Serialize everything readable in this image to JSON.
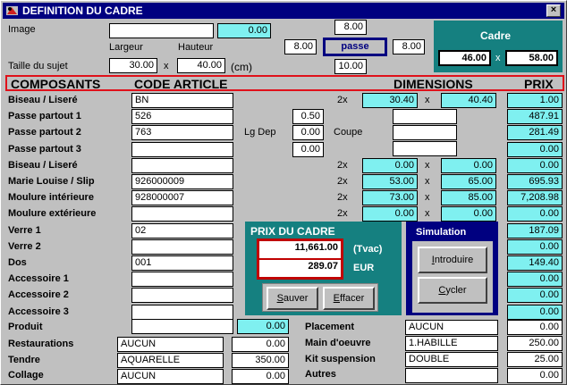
{
  "window": {
    "title": "DEFINITION DU CADRE",
    "close_label": "×"
  },
  "top": {
    "image_label": "Image",
    "image_value": "",
    "image_price": "0.00",
    "largeur_label": "Largeur",
    "hauteur_label": "Hauteur",
    "taille_label": "Taille du sujet",
    "largeur_value": "30.00",
    "x_sign": "x",
    "hauteur_value": "40.00",
    "unit": "(cm)",
    "passe_top": "8.00",
    "passe_left": "8.00",
    "passe_label": "passe",
    "passe_right": "8.00",
    "passe_bottom": "10.00",
    "cadre_title": "Cadre",
    "cadre_w": "46.00",
    "cadre_h": "58.00"
  },
  "header": {
    "composants": "COMPOSANTS",
    "code_article": "CODE ARTICLE",
    "dimensions": "DIMENSIONS",
    "prix": "PRIX"
  },
  "rows": [
    {
      "label": "Biseau / Liseré",
      "code": "BN",
      "mult": "2x",
      "dim1": "30.40",
      "x": "x",
      "dim2": "40.40",
      "prix": "1.00"
    },
    {
      "label": "Passe partout 1",
      "code": "526",
      "lg": "0.50",
      "prix": "487.91"
    },
    {
      "label": "Passe partout 2",
      "code": "763",
      "lg": "0.00",
      "prix": "281.49"
    },
    {
      "label": "Passe partout 3",
      "code": "",
      "lg": "0.00",
      "prix": "0.00"
    },
    {
      "label": "Biseau / Liseré",
      "code": "",
      "mult": "2x",
      "dim1": "0.00",
      "x": "x",
      "dim2": "0.00",
      "prix": "0.00"
    },
    {
      "label": "Marie Louise / Slip",
      "code": "926000009",
      "mult": "2x",
      "dim1": "53.00",
      "x": "x",
      "dim2": "65.00",
      "prix": "695.93"
    },
    {
      "label": "Moulure intérieure",
      "code": "928000007",
      "mult": "2x",
      "dim1": "73.00",
      "x": "x",
      "dim2": "85.00",
      "prix": "7,208.98"
    },
    {
      "label": "Moulure extérieure",
      "code": "",
      "mult": "2x",
      "dim1": "0.00",
      "x": "x",
      "dim2": "0.00",
      "prix": "0.00"
    },
    {
      "label": "Verre 1",
      "code": "02",
      "prix": "187.09"
    },
    {
      "label": "Verre 2",
      "code": "",
      "prix": "0.00"
    },
    {
      "label": "Dos",
      "code": "001",
      "prix": "149.40"
    },
    {
      "label": "Accessoire 1",
      "code": "",
      "prix": "0.00"
    },
    {
      "label": "Accessoire 2",
      "code": "",
      "prix": "0.00"
    },
    {
      "label": "Accessoire 3",
      "code": "",
      "prix": "0.00"
    }
  ],
  "lgdep_label": "Lg Dep",
  "coupe_label": "Coupe",
  "prix_cadre": {
    "title": "PRIX DU CADRE",
    "tvac_value": "11,661.00",
    "tvac_label": "(Tvac)",
    "eur_value": "289.07",
    "eur_label": "EUR",
    "sauver": "Sauver",
    "effacer": "Effacer"
  },
  "simulation": {
    "title": "Simulation",
    "introduire": "Introduire",
    "cycler": "Cycler"
  },
  "bottom_left": {
    "produit_label": "Produit",
    "produit_code": "",
    "produit_prix": "0.00",
    "restaurations_label": "Restaurations",
    "restaurations_value": "AUCUN",
    "restaurations_prix": "0.00",
    "tendre_label": "Tendre",
    "tendre_value": "AQUARELLE",
    "tendre_prix": "350.00",
    "collage_label": "Collage",
    "collage_value": "AUCUN",
    "collage_prix": "0.00"
  },
  "bottom_right": {
    "placement_label": "Placement",
    "placement_value": "AUCUN",
    "placement_prix": "0.00",
    "main_label": "Main d'oeuvre",
    "main_value": "1.HABILLE",
    "main_prix": "250.00",
    "kit_label": "Kit suspension",
    "kit_value": "DOUBLE",
    "kit_prix": "25.00",
    "autres_label": "Autres",
    "autres_value": "",
    "autres_prix": "0.00"
  }
}
